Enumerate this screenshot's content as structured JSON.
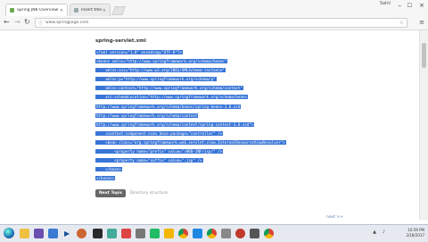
{
  "browser": {
    "tabs": [
      {
        "title": "Spring JNK Overview"
      },
      {
        "title": "Insert title here"
      }
    ],
    "tab_close_glyph": "×",
    "url": "www.springpage.com",
    "window_user": "Sahil"
  },
  "page": {
    "title": "spring-servlet.xml",
    "code_lines": [
      "<?xml version=\"1.0\" encoding=\"UTF-8\"?>",
      "<beans xmlns=\"http://www.springframework.org/schema/beans\"",
      "    xmlns:xsi=\"http://www.w3.org/2001/XMLSchema-instance\"",
      "    xmlns:p=\"http://www.springframework.org/schema/p\"",
      "    xmlns:context=\"http://www.springframework.org/schema/context\"",
      "    xsi:schemaLocation=\"http://www.springframework.org/schema/beans",
      "http://www.springframework.org/schema/beans/spring-beans-3.0.xsd",
      "http://www.springframework.org/schema/context",
      "http://www.springframework.org/schema/context/spring-context-3.0.xsd\">",
      "    <context:component-scan base-package=\"controller\" />",
      "    <bean class=\"org.springframework.web.servlet.view.InternalResourceViewResolver\">",
      "        <property name=\"prefix\" value=\"/WEB-INF/jsp/\" />",
      "        <property name=\"suffix\" value=\".jsp\" />",
      "    </bean>",
      "</beans>"
    ],
    "next_topic_label": "Next Topic",
    "next_topic_title": "Directory structure",
    "next_link": "next >>"
  },
  "taskbar": {
    "time": "10:59 PM",
    "date": "2/18/2017"
  },
  "colors": {
    "selection": "#3875d7",
    "accent": "#5b7bb0"
  }
}
